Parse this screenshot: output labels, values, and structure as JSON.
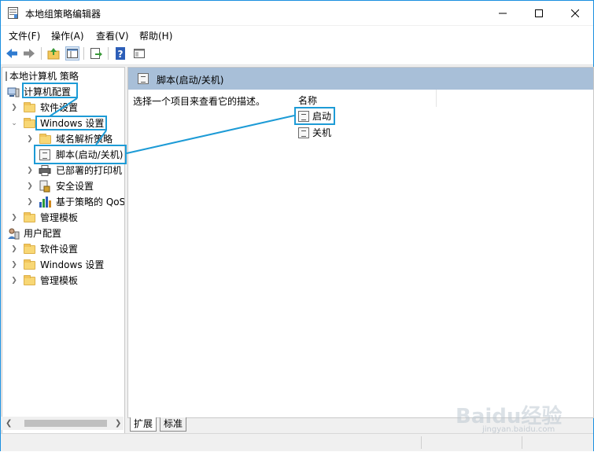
{
  "window": {
    "title": "本地组策略编辑器"
  },
  "menu": [
    "文件(F)",
    "操作(A)",
    "查看(V)",
    "帮助(H)"
  ],
  "tree": {
    "root": "本地计算机 策略",
    "computer_config": "计算机配置",
    "software_settings": "软件设置",
    "windows_settings": "Windows 设置",
    "dns_policy": "域名解析策略",
    "scripts": "脚本(启动/关机)",
    "deployed_printers": "已部署的打印机",
    "security_settings": "安全设置",
    "qos": "基于策略的 QoS",
    "admin_templates": "管理模板",
    "user_config": "用户配置",
    "user_software_settings": "软件设置",
    "user_windows_settings": "Windows 设置",
    "user_admin_templates": "管理模板"
  },
  "detail": {
    "header_title": "脚本(启动/关机)",
    "description": "选择一个项目来查看它的描述。",
    "column_name": "名称",
    "items": [
      "启动",
      "关机"
    ]
  },
  "tabs": [
    "扩展",
    "标准"
  ],
  "watermark": {
    "text": "Baidu经验",
    "url": "jingyan.baidu.com"
  },
  "colors": {
    "accent": "#1d9bd6",
    "header": "#a8bfd8"
  }
}
